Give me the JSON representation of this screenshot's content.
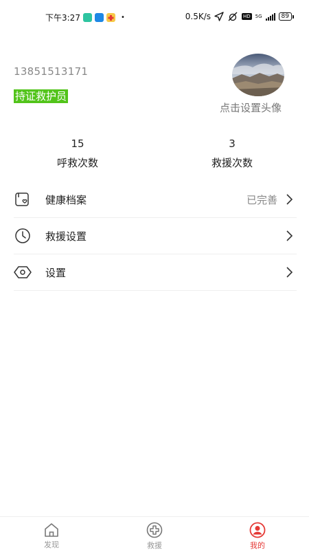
{
  "status_bar": {
    "time": "下午3:27",
    "network_speed": "0.5K/s",
    "hd_badge": "HD",
    "network_type": "5G",
    "battery": "89"
  },
  "profile": {
    "phone": "13851513171",
    "certification": "持证救护员",
    "avatar_hint": "点击设置头像"
  },
  "stats": [
    {
      "value": "15",
      "label": "呼救次数"
    },
    {
      "value": "3",
      "label": "救援次数"
    }
  ],
  "menu": [
    {
      "label": "健康档案",
      "value": "已完善",
      "icon": "health-record-icon"
    },
    {
      "label": "救援设置",
      "value": "",
      "icon": "clock-icon"
    },
    {
      "label": "设置",
      "value": "",
      "icon": "settings-icon"
    }
  ],
  "bottom_nav": {
    "active_color": "#e53935",
    "tabs": [
      {
        "label": "发现",
        "icon": "home-icon"
      },
      {
        "label": "救援",
        "icon": "plus-circle-icon"
      },
      {
        "label": "我的",
        "icon": "profile-icon"
      }
    ]
  }
}
